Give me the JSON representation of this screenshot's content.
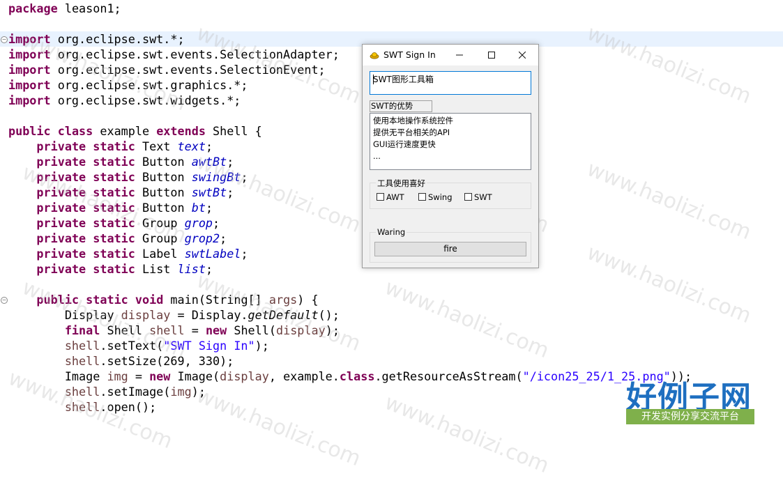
{
  "editor": {
    "lines": [
      [
        [
          "kw",
          "package"
        ],
        [
          "t",
          " leason1;"
        ]
      ],
      [],
      [
        [
          "kw",
          "import"
        ],
        [
          "t",
          " org.eclipse.swt.*;"
        ]
      ],
      [
        [
          "kw",
          "import"
        ],
        [
          "t",
          " org.eclipse.swt.events.SelectionAdapter;"
        ]
      ],
      [
        [
          "kw",
          "import"
        ],
        [
          "t",
          " org.eclipse.swt.events.SelectionEvent;"
        ]
      ],
      [
        [
          "kw",
          "import"
        ],
        [
          "t",
          " org.eclipse.swt.graphics.*;"
        ]
      ],
      [
        [
          "kw",
          "import"
        ],
        [
          "t",
          " org.eclipse.swt.widgets.*;"
        ]
      ],
      [],
      [
        [
          "kw",
          "public"
        ],
        [
          "t",
          " "
        ],
        [
          "kw",
          "class"
        ],
        [
          "t",
          " example "
        ],
        [
          "kw",
          "extends"
        ],
        [
          "t",
          " Shell {"
        ]
      ],
      [
        [
          "t",
          "    "
        ],
        [
          "kw",
          "private"
        ],
        [
          "t",
          " "
        ],
        [
          "kw",
          "static"
        ],
        [
          "t",
          " Text "
        ],
        [
          "fld",
          "text"
        ],
        [
          "t",
          ";"
        ]
      ],
      [
        [
          "t",
          "    "
        ],
        [
          "kw",
          "private"
        ],
        [
          "t",
          " "
        ],
        [
          "kw",
          "static"
        ],
        [
          "t",
          " Button "
        ],
        [
          "fld",
          "awtBt"
        ],
        [
          "t",
          ";"
        ]
      ],
      [
        [
          "t",
          "    "
        ],
        [
          "kw",
          "private"
        ],
        [
          "t",
          " "
        ],
        [
          "kw",
          "static"
        ],
        [
          "t",
          " Button "
        ],
        [
          "fld",
          "swingBt"
        ],
        [
          "t",
          ";"
        ]
      ],
      [
        [
          "t",
          "    "
        ],
        [
          "kw",
          "private"
        ],
        [
          "t",
          " "
        ],
        [
          "kw",
          "static"
        ],
        [
          "t",
          " Button "
        ],
        [
          "fld",
          "swtBt"
        ],
        [
          "t",
          ";"
        ]
      ],
      [
        [
          "t",
          "    "
        ],
        [
          "kw",
          "private"
        ],
        [
          "t",
          " "
        ],
        [
          "kw",
          "static"
        ],
        [
          "t",
          " Button "
        ],
        [
          "fld",
          "bt"
        ],
        [
          "t",
          ";"
        ]
      ],
      [
        [
          "t",
          "    "
        ],
        [
          "kw",
          "private"
        ],
        [
          "t",
          " "
        ],
        [
          "kw",
          "static"
        ],
        [
          "t",
          " Group "
        ],
        [
          "fld",
          "grop"
        ],
        [
          "t",
          ";"
        ]
      ],
      [
        [
          "t",
          "    "
        ],
        [
          "kw",
          "private"
        ],
        [
          "t",
          " "
        ],
        [
          "kw",
          "static"
        ],
        [
          "t",
          " Group "
        ],
        [
          "fld",
          "grop2"
        ],
        [
          "t",
          ";"
        ]
      ],
      [
        [
          "t",
          "    "
        ],
        [
          "kw",
          "private"
        ],
        [
          "t",
          " "
        ],
        [
          "kw",
          "static"
        ],
        [
          "t",
          " Label "
        ],
        [
          "fld",
          "swtLabel"
        ],
        [
          "t",
          ";"
        ]
      ],
      [
        [
          "t",
          "    "
        ],
        [
          "kw",
          "private"
        ],
        [
          "t",
          " "
        ],
        [
          "kw",
          "static"
        ],
        [
          "t",
          " List "
        ],
        [
          "fld",
          "list"
        ],
        [
          "t",
          ";"
        ]
      ],
      [],
      [
        [
          "t",
          "    "
        ],
        [
          "kw",
          "public"
        ],
        [
          "t",
          " "
        ],
        [
          "kw",
          "static"
        ],
        [
          "t",
          " "
        ],
        [
          "kw",
          "void"
        ],
        [
          "t",
          " main(String[] "
        ],
        [
          "var",
          "args"
        ],
        [
          "t",
          ") {"
        ]
      ],
      [
        [
          "t",
          "        Display "
        ],
        [
          "var",
          "display"
        ],
        [
          "t",
          " = Display."
        ],
        [
          "mth",
          "getDefault"
        ],
        [
          "t",
          "();"
        ]
      ],
      [
        [
          "t",
          "        "
        ],
        [
          "kw",
          "final"
        ],
        [
          "t",
          " Shell "
        ],
        [
          "var",
          "shell"
        ],
        [
          "t",
          " = "
        ],
        [
          "kw",
          "new"
        ],
        [
          "t",
          " Shell("
        ],
        [
          "var",
          "display"
        ],
        [
          "t",
          ");"
        ]
      ],
      [
        [
          "t",
          "        "
        ],
        [
          "var",
          "shell"
        ],
        [
          "t",
          ".setText("
        ],
        [
          "str",
          "\"SWT Sign In\""
        ],
        [
          "t",
          ");"
        ]
      ],
      [
        [
          "t",
          "        "
        ],
        [
          "var",
          "shell"
        ],
        [
          "t",
          ".setSize(269, 330);"
        ]
      ],
      [
        [
          "t",
          "        Image "
        ],
        [
          "var",
          "img"
        ],
        [
          "t",
          " = "
        ],
        [
          "kw",
          "new"
        ],
        [
          "t",
          " Image("
        ],
        [
          "var",
          "display"
        ],
        [
          "t",
          ", example."
        ],
        [
          "kw",
          "class"
        ],
        [
          "t",
          ".getResourceAsStream("
        ],
        [
          "str",
          "\"/icon25_25/1_25.png\""
        ],
        [
          "t",
          "));"
        ]
      ],
      [
        [
          "t",
          "        "
        ],
        [
          "var",
          "shell"
        ],
        [
          "t",
          ".setImage("
        ],
        [
          "var",
          "img"
        ],
        [
          "t",
          ");"
        ]
      ],
      [
        [
          "t",
          "        "
        ],
        [
          "var",
          "shell"
        ],
        [
          "t",
          ".open();"
        ]
      ]
    ]
  },
  "watermark": {
    "text": "www.haolizi.com"
  },
  "brand": {
    "name": "好例子网",
    "tagline": "开发实例分享交流平台"
  },
  "dialog": {
    "title": "SWT Sign In",
    "text_field": {
      "value": "SWT图形工具箱"
    },
    "label": "SWT的优势",
    "list_items": [
      "使用本地操作系统控件",
      "提供无平台相关的API",
      "GUI运行速度更快",
      "..."
    ],
    "group_preference": {
      "title": "工具使用喜好",
      "checkboxes": [
        {
          "label": "AWT",
          "checked": false
        },
        {
          "label": "Swing",
          "checked": false
        },
        {
          "label": "SWT",
          "checked": false
        }
      ]
    },
    "group_warning": {
      "title": "Waring",
      "button_label": "fire"
    }
  },
  "colors": {
    "keyword": "#7f0055",
    "field": "#0000c0",
    "string": "#2a00ff",
    "local_var": "#6a3e3e",
    "line_highlight": "#e8f2fe",
    "focus_border": "#0078d7"
  }
}
